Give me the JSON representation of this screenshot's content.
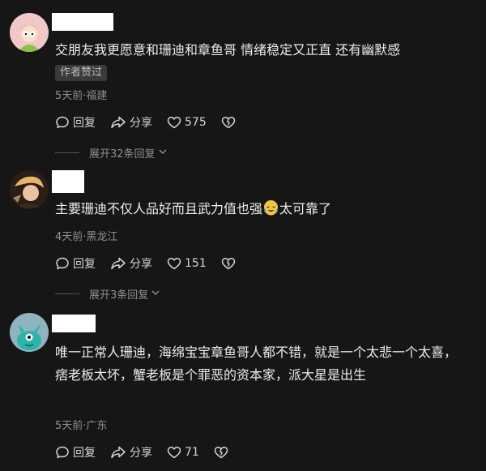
{
  "comments": [
    {
      "text": "交朋友我更愿意和珊迪和章鱼哥 情绪稳定又正直 还有幽默感",
      "badge": "作者赞过",
      "meta": "5天前·福建",
      "reply": "回复",
      "share": "分享",
      "likes": "575",
      "expand": "展开32条回复"
    },
    {
      "text": "主要珊迪不仅人品好而且武力值也强",
      "text_after": "太可靠了",
      "emoji": "laughing-tears-emoji",
      "meta": "4天前·黑龙江",
      "reply": "回复",
      "share": "分享",
      "likes": "151",
      "expand": "展开3条回复"
    },
    {
      "text": "唯一正常人珊迪，海绵宝宝章鱼哥人都不错，就是一个太悲一个太喜，痞老板太坏，蟹老板是个罪恶的资本家，派大星是出生",
      "meta": "5天前·广东",
      "reply": "回复",
      "share": "分享",
      "likes": "71"
    }
  ],
  "colors": {
    "background": "#161616",
    "avatar1": "#f2c7c7",
    "avatar3": "#8fb3bf",
    "avatar3_creature": "#2bb5a6"
  }
}
